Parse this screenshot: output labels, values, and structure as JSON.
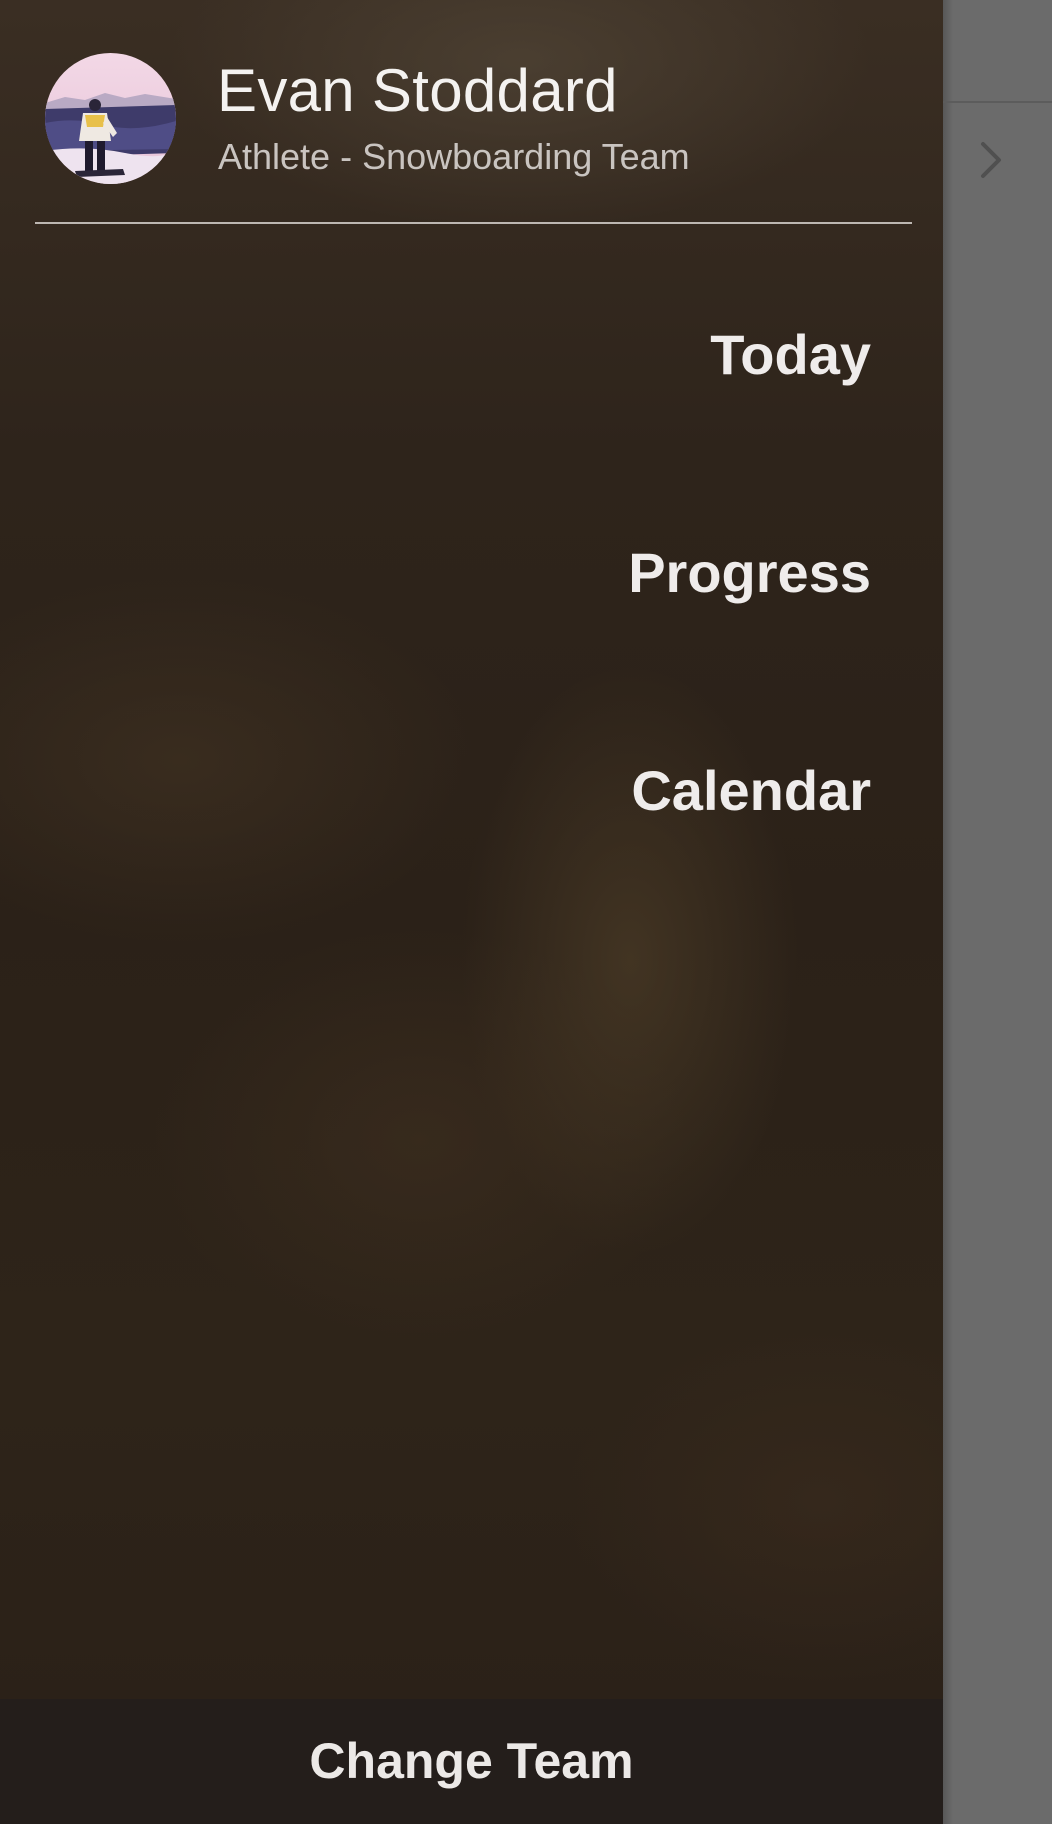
{
  "profile": {
    "name": "Evan Stoddard",
    "role": "Athlete - Snowboarding Team",
    "avatar_icon": "snowboarder-photo"
  },
  "menu": {
    "items": [
      {
        "label": "Today"
      },
      {
        "label": "Progress"
      },
      {
        "label": "Calendar"
      }
    ]
  },
  "footer": {
    "change_team_label": "Change Team"
  },
  "underlay": {
    "icon": "chevron-right-icon"
  },
  "colors": {
    "drawer_background": "#2e241b",
    "footer_background": "#241e1b",
    "text_primary": "#efeceb",
    "text_secondary": "#c9c4c0",
    "dimmed_overlay": "#6b6b6b"
  }
}
